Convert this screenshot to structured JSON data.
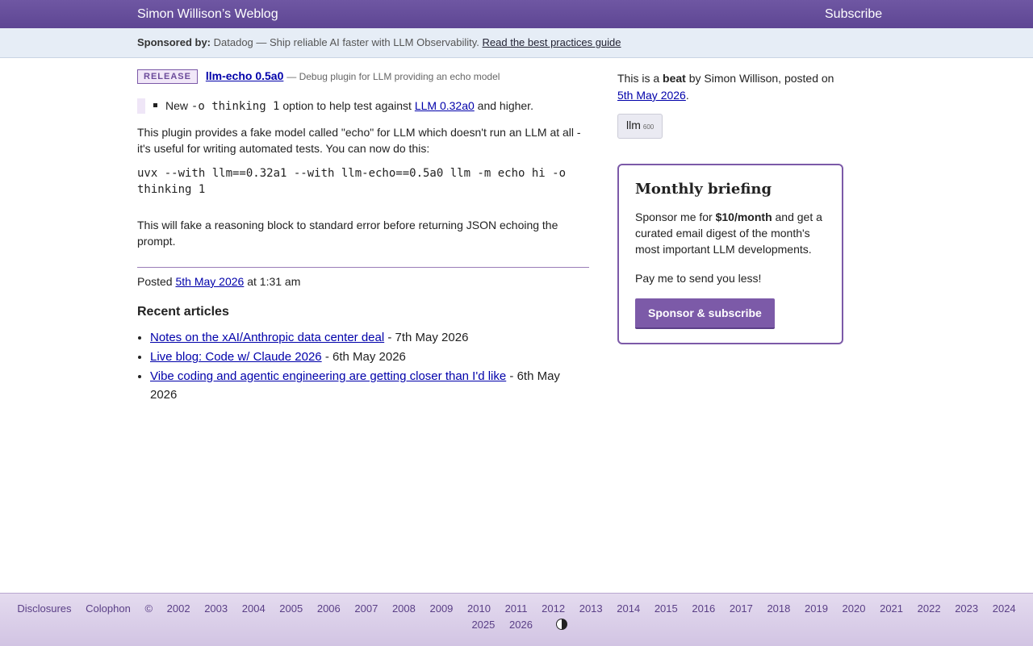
{
  "header": {
    "site_title": "Simon Willison’s Weblog",
    "subscribe": "Subscribe"
  },
  "sponsor": {
    "label": "Sponsored by:",
    "text": "Datadog — Ship reliable AI faster with LLM Observability.",
    "link": "Read the best practices guide"
  },
  "beat": {
    "badge": "RELEASE",
    "title": "llm-echo 0.5a0",
    "desc": "— Debug plugin for LLM providing an echo model",
    "note_prefix": "New",
    "note_code": "-o thinking 1",
    "note_mid": "option to help test against",
    "note_link": "LLM 0.32a0",
    "note_suffix": "and higher.",
    "para1": "This plugin provides a fake model called \"echo\" for LLM which doesn't run an LLM at all - it's useful for writing automated tests. You can now do this:",
    "code": "uvx --with llm==0.32a1 --with llm-echo==0.5a0 llm -m echo hi -o thinking 1",
    "para2": "This will fake a reasoning block to standard error before returning JSON echoing the prompt.",
    "posted_prefix": "Posted",
    "posted_date": "5th May 2026",
    "posted_time": "at 1:31 am"
  },
  "recent": {
    "heading": "Recent articles",
    "items": [
      {
        "title": "Notes on the xAI/Anthropic data center deal",
        "date": "- 7th May 2026"
      },
      {
        "title": "Live blog: Code w/ Claude 2026",
        "date": "- 6th May 2026"
      },
      {
        "title": "Vibe coding and agentic engineering are getting closer than I'd like",
        "date": "- 6th May 2026"
      }
    ]
  },
  "sidebar": {
    "intro_pre": "This is a",
    "intro_bold": "beat",
    "intro_post": "by Simon Willison, posted on",
    "date": "5th May 2026",
    "tag": "llm",
    "tag_count": "600"
  },
  "card": {
    "title": "Monthly briefing",
    "pre": "Sponsor me for",
    "price": "$10/month",
    "post": "and get a curated email digest of the month's most important LLM developments.",
    "line2": "Pay me to send you less!",
    "button": "Sponsor & subscribe"
  },
  "footer": {
    "links": [
      "Disclosures",
      "Colophon",
      "©",
      "2002",
      "2003",
      "2004",
      "2005",
      "2006",
      "2007",
      "2008",
      "2009",
      "2010",
      "2011",
      "2012",
      "2013",
      "2014",
      "2015",
      "2016",
      "2017",
      "2018",
      "2019",
      "2020",
      "2021",
      "2022",
      "2023",
      "2024",
      "2025",
      "2026"
    ],
    "contrast_icon": "contrast-toggle-icon"
  }
}
